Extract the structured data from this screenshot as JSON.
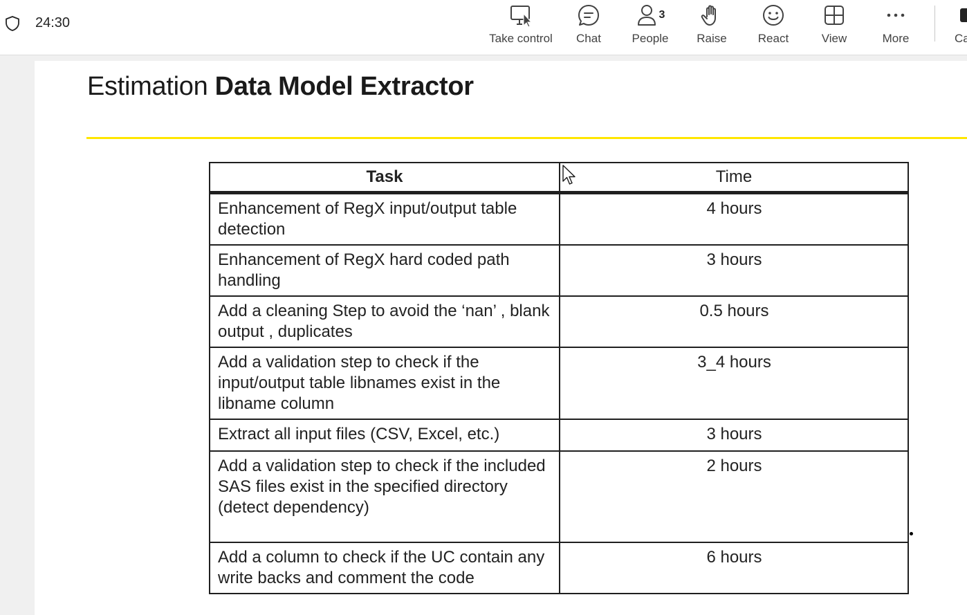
{
  "meeting": {
    "timer": "24:30",
    "toolbar": [
      {
        "label": "Take control",
        "icon": "take-control-icon"
      },
      {
        "label": "Chat",
        "icon": "chat-icon"
      },
      {
        "label": "People",
        "icon": "people-icon",
        "count": "3"
      },
      {
        "label": "Raise",
        "icon": "raise-hand-icon"
      },
      {
        "label": "React",
        "icon": "react-icon"
      },
      {
        "label": "View",
        "icon": "view-icon"
      },
      {
        "label": "More",
        "icon": "more-icon"
      },
      {
        "label": "Ca",
        "icon": "camera-icon"
      }
    ]
  },
  "slide": {
    "title_regular": "Estimation ",
    "title_bold": "Data Model Extractor",
    "accent_color": "#ffe600",
    "table": {
      "headers": {
        "task": "Task",
        "time": "Time"
      },
      "rows": [
        {
          "task": "Enhancement of RegX input/output table detection",
          "time": "4 hours"
        },
        {
          "task": "Enhancement of RegX hard coded path handling",
          "time": "3 hours"
        },
        {
          "task": "Add a cleaning Step to avoid the ‘nan’ , blank output , duplicates",
          "time": "0.5 hours"
        },
        {
          "task": "Add a validation step to check if the input/output table libnames exist in the libname column",
          "time": "3_4 hours"
        },
        {
          "task": "Extract all input files (CSV, Excel, etc.)",
          "time": "3 hours"
        },
        {
          "task": "Add a validation step to check if the included SAS files exist in the specified directory (detect dependency)",
          "time": "2 hours"
        },
        {
          "task": "Add a column to check if the UC contain any write backs  and  comment the code",
          "time": "6 hours"
        }
      ]
    }
  }
}
